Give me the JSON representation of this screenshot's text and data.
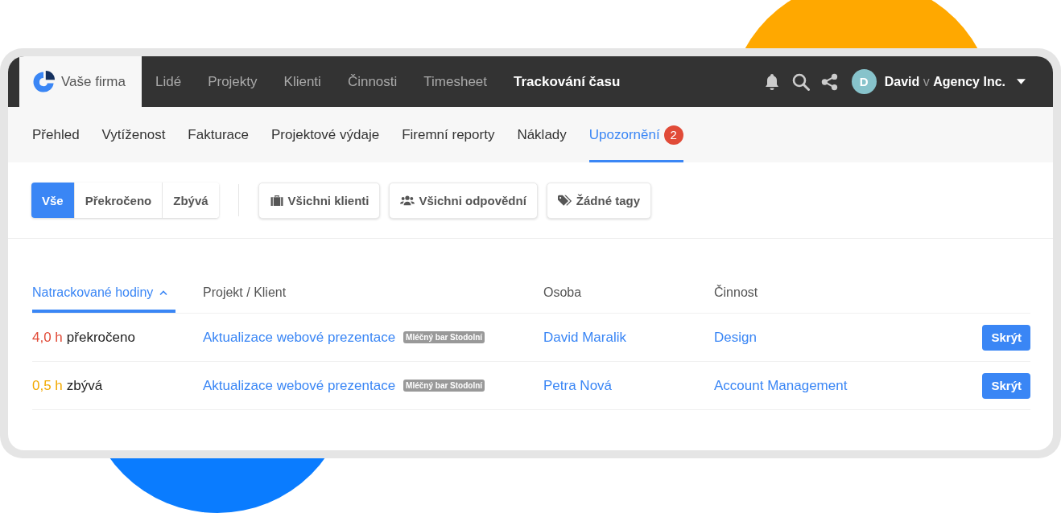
{
  "brand": {
    "label": "Vaše firma"
  },
  "top_nav": [
    {
      "label": "Lidé",
      "selected": false
    },
    {
      "label": "Projekty",
      "selected": false
    },
    {
      "label": "Klienti",
      "selected": false
    },
    {
      "label": "Činnosti",
      "selected": false
    },
    {
      "label": "Timesheet",
      "selected": false
    },
    {
      "label": "Trackování času",
      "selected": true
    }
  ],
  "user": {
    "avatar": "D",
    "name": "David",
    "connector": "v",
    "company": "Agency Inc."
  },
  "sub_nav": [
    {
      "label": "Přehled",
      "selected": false
    },
    {
      "label": "Vytíženost",
      "selected": false
    },
    {
      "label": "Fakturace",
      "selected": false
    },
    {
      "label": "Projektové výdaje",
      "selected": false
    },
    {
      "label": "Firemní reporty",
      "selected": false
    },
    {
      "label": "Náklady",
      "selected": false
    },
    {
      "label": "Upozornění",
      "selected": true,
      "badge": "2"
    }
  ],
  "segments": [
    {
      "label": "Vše",
      "selected": true
    },
    {
      "label": "Překročeno",
      "selected": false
    },
    {
      "label": "Zbývá",
      "selected": false
    }
  ],
  "filters": [
    {
      "kind": "clients",
      "label": "Všichni klienti"
    },
    {
      "kind": "people",
      "label": "Všichni odpovědní"
    },
    {
      "kind": "tags",
      "label": "Žádné tagy"
    }
  ],
  "table": {
    "columns": [
      {
        "label": "Natrackované hodiny",
        "sorted": true
      },
      {
        "label": "Projekt / Klient",
        "sorted": false
      },
      {
        "label": "Osoba",
        "sorted": false
      },
      {
        "label": "Činnost",
        "sorted": false
      }
    ],
    "rows": [
      {
        "hours": "4,0 h",
        "kind": "over",
        "status_label": "překročeno",
        "project": "Aktualizace webové prezentace",
        "client": "Mléčný bar Stodolní",
        "person": "David Maralik",
        "activity": "Design",
        "action": "Skrýt"
      },
      {
        "hours": "0,5 h",
        "kind": "remaining",
        "status_label": "zbývá",
        "project": "Aktualizace webové prezentace",
        "client": "Mléčný bar Stodolní",
        "person": "Petra Nová",
        "activity": "Account Management",
        "action": "Skrýt"
      }
    ]
  }
}
